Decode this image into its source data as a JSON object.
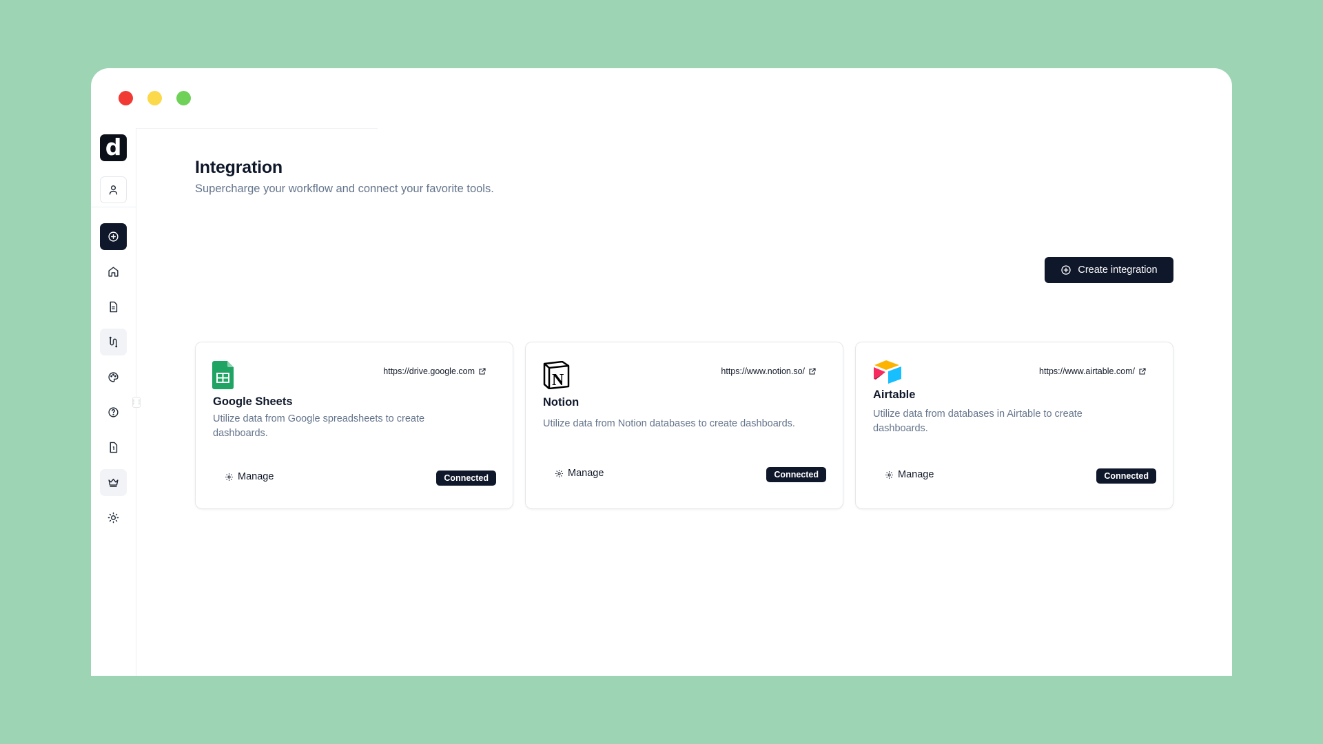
{
  "brand": {
    "logo_letter": "d"
  },
  "sidebar": {
    "items": [
      {
        "name": "user-icon"
      },
      {
        "name": "plus-circle-icon"
      },
      {
        "name": "home-icon"
      },
      {
        "name": "document-icon"
      },
      {
        "name": "integration-icon"
      },
      {
        "name": "palette-icon"
      },
      {
        "name": "help-icon"
      },
      {
        "name": "file-icon"
      },
      {
        "name": "crown-icon"
      },
      {
        "name": "sun-icon"
      }
    ]
  },
  "header": {
    "title": "Integration",
    "subtitle": "Supercharge your workflow and connect your favorite tools."
  },
  "actions": {
    "create_label": "Create integration"
  },
  "integrations": [
    {
      "name": "Google Sheets",
      "url": "https://drive.google.com",
      "description": "Utilize data from Google spreadsheets to create dashboards.",
      "manage_label": "Manage",
      "status": "Connected",
      "icon": "google-sheets-icon"
    },
    {
      "name": "Notion",
      "url": "https://www.notion.so/",
      "description": "Utilize data from Notion databases to create dashboards.",
      "manage_label": "Manage",
      "status": "Connected",
      "icon": "notion-icon"
    },
    {
      "name": "Airtable",
      "url": "https://www.airtable.com/",
      "description": "Utilize data from databases in Airtable to create dashboards.",
      "manage_label": "Manage",
      "status": "Connected",
      "icon": "airtable-icon"
    }
  ],
  "colors": {
    "background": "#9dd4b4",
    "primary": "#0f172a",
    "muted_text": "#64748b"
  }
}
